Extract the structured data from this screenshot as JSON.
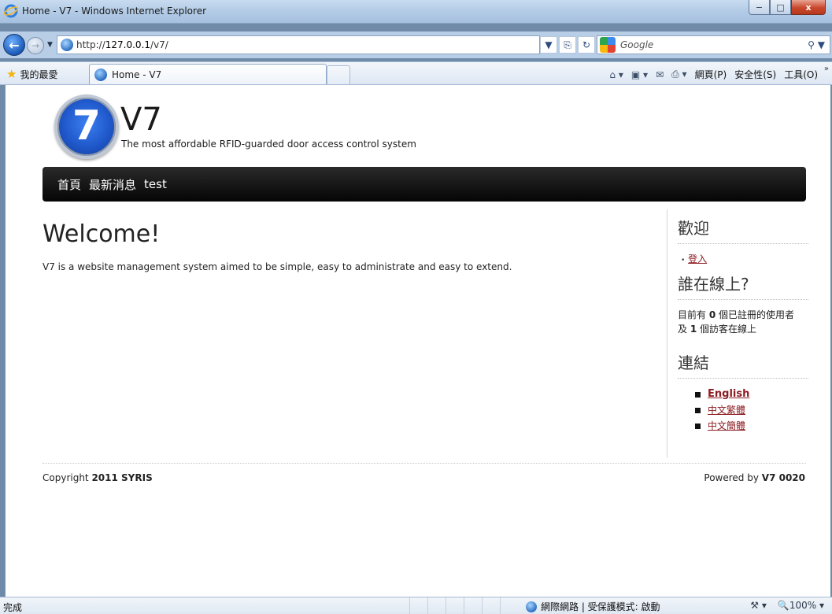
{
  "window": {
    "title": "Home - V7 - Windows Internet Explorer",
    "minimize": "−",
    "maximize": "□",
    "close": "x"
  },
  "address_bar": {
    "url_prefix": "http://",
    "url_host": "127.0.0.1",
    "url_path": "/v7/"
  },
  "search": {
    "placeholder": "Google",
    "icon": "magnifier-icon"
  },
  "favorites": {
    "label": "我的最愛",
    "tab_title": "Home - V7"
  },
  "command_bar": {
    "page": "網頁(P)",
    "safety": "安全性(S)",
    "tools": "工具(O)"
  },
  "site": {
    "logo_text": "7",
    "title": "V7",
    "slogan": "The most affordable RFID-guarded door access control system"
  },
  "nav": {
    "items": [
      "首頁",
      "最新消息",
      "test"
    ]
  },
  "content": {
    "heading": "Welcome!",
    "body": "V7 is a website management system aimed to be simple, easy to administrate and easy to extend."
  },
  "sidebar": {
    "welcome_heading": "歡迎",
    "login_link": "登入",
    "online_heading": "誰在線上?",
    "online_line1_pre": "目前有 ",
    "online_registered": "0",
    "online_line1_post": " 個已註冊的使用者",
    "online_line2_pre": "及 ",
    "online_guests": "1",
    "online_line2_post": " 個訪客在線上",
    "links_heading": "連結",
    "links": [
      "English",
      "中文繁體",
      "中文簡體"
    ]
  },
  "footer": {
    "copyright_pre": "Copyright ",
    "copyright_bold": "2011 SYRIS",
    "powered_pre": "Powered by ",
    "powered_bold": "V7 0020"
  },
  "statusbar": {
    "status": "完成",
    "zone": "網際網路 | 受保護模式: 啟動",
    "zoom": "100%"
  }
}
